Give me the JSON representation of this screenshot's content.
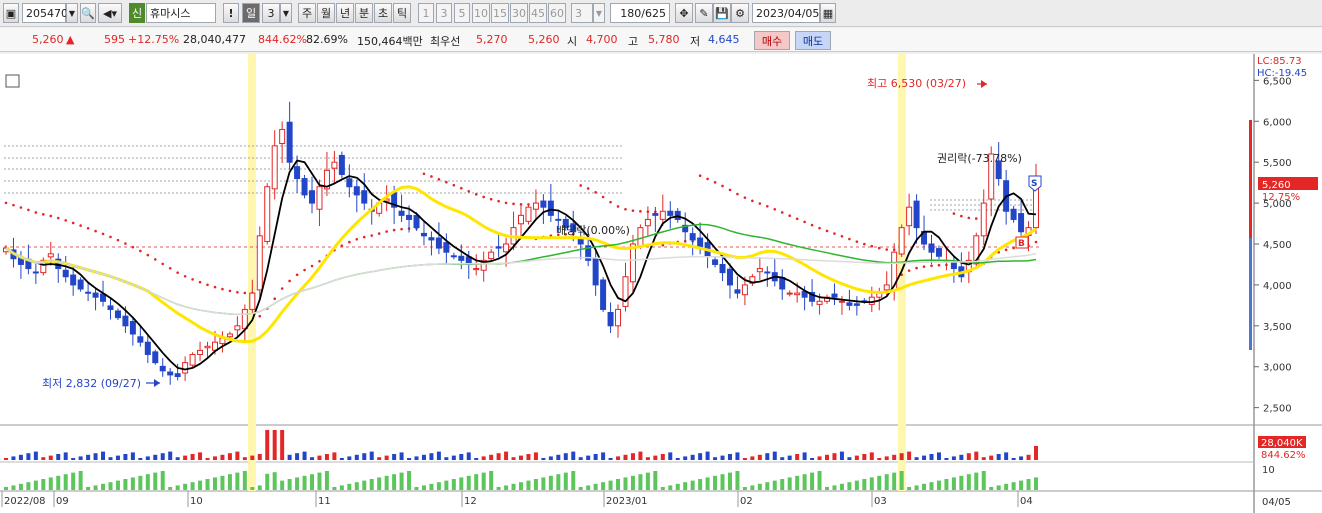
{
  "toolbar": {
    "code": "205470",
    "market_badge": "신",
    "stock_name": "휴마시스",
    "alert_label": "!",
    "period_buttons": [
      "일",
      "3",
      "주",
      "월",
      "년",
      "분",
      "초",
      "틱"
    ],
    "selected_period": "일",
    "interval_buttons": [
      "1",
      "3",
      "5",
      "10",
      "15",
      "30",
      "45",
      "60"
    ],
    "custom_interval": "3",
    "count": "180/625",
    "date": "2023/04/05"
  },
  "quote": {
    "price": "5,260",
    "arrow": "▲",
    "change": "595",
    "change_pct": "+12.75%",
    "volume": "28,040,477",
    "volume_ratio": "844.62%",
    "turnover_ratio": "82.69%",
    "amount": "150,464백만",
    "best_ask_label": "최우선",
    "best_ask": "5,270",
    "best_bid": "5,260",
    "open_label": "시",
    "open": "4,700",
    "high_label": "고",
    "high": "5,780",
    "low_label": "저",
    "low": "4,645",
    "buy_label": "매수",
    "sell_label": "매도"
  },
  "chart_data": {
    "type": "candlestick",
    "y_axis": {
      "ticks": [
        "6,500",
        "6,000",
        "5,500",
        "5,000",
        "4,500",
        "4,000",
        "3,500",
        "3,000",
        "2,500"
      ],
      "range": [
        2300,
        6700
      ]
    },
    "x_axis_labels": [
      "2022/08",
      "09",
      "10",
      "11",
      "12",
      "2023/01",
      "02",
      "03",
      "04"
    ],
    "x_axis_right_label": "04/05",
    "indicator_readout": {
      "lc": "LC:85.73",
      "hc": "HC:-19.45"
    },
    "current_price_tag": {
      "price": "5,260",
      "pct": "12.75%"
    },
    "volume_tag": {
      "volume": "28,040K",
      "pct": "844.62%"
    },
    "lower_panel_tick": "10",
    "annotations": {
      "high_marker": "최고 6,530 (03/27)",
      "low_marker": "최저 2,832 (09/27)",
      "dividend_label": "배당락(0.00%)",
      "rights_label": "권리락(-73.78%)",
      "buy_signal": "B",
      "sell_signal": "S"
    },
    "candles_close_approx": [
      4450,
      4320,
      4250,
      4200,
      4150,
      4300,
      4380,
      4200,
      4100,
      4000,
      3950,
      3900,
      3850,
      3800,
      3700,
      3600,
      3500,
      3400,
      3300,
      3150,
      3050,
      2950,
      2900,
      2880,
      3050,
      3150,
      3200,
      3250,
      3300,
      3350,
      3400,
      3500,
      3700,
      3900,
      4600,
      5200,
      5700,
      5900,
      5500,
      5300,
      5100,
      5000,
      5200,
      5400,
      5500,
      5350,
      5200,
      5100,
      5000,
      4900,
      5000,
      5050,
      4950,
      4850,
      4800,
      4700,
      4600,
      4550,
      4450,
      4400,
      4350,
      4300,
      4250,
      4200,
      4300,
      4400,
      4450,
      4500,
      4700,
      4850,
      4950,
      5000,
      4950,
      4850,
      4800,
      4700,
      4650,
      4500,
      4300,
      4000,
      3700,
      3500,
      3700,
      4100,
      4500,
      4700,
      4800,
      4850,
      4900,
      4850,
      4800,
      4650,
      4550,
      4450,
      4350,
      4250,
      4150,
      4000,
      3900,
      4000,
      4100,
      4200,
      4150,
      4050,
      3950,
      3900,
      3900,
      3850,
      3800,
      3800,
      3850,
      3850,
      3800,
      3750,
      3750,
      3800,
      3850,
      3900,
      4000,
      4400,
      4700,
      4950,
      4700,
      4500,
      4400,
      4350,
      4300,
      4200,
      4100,
      4300,
      4600,
      5000,
      5600,
      5300,
      4900,
      4800,
      4650,
      4700,
      5260
    ],
    "moving_averages": [
      {
        "color": "#000000",
        "label": "MA5"
      },
      {
        "color": "#ffe600",
        "label": "MA20"
      },
      {
        "color": "#2fb52f",
        "label": "MA60"
      },
      {
        "color": "#ffffff",
        "label": "MA120"
      }
    ],
    "colors": {
      "up": "#e32626",
      "down": "#2346c8",
      "highlight_band": "#fff6b0",
      "parabolic": "#e32626",
      "volume_up": "#e32626",
      "volume_down": "#2346c8",
      "lower_indicator": "#5cc65c"
    }
  }
}
